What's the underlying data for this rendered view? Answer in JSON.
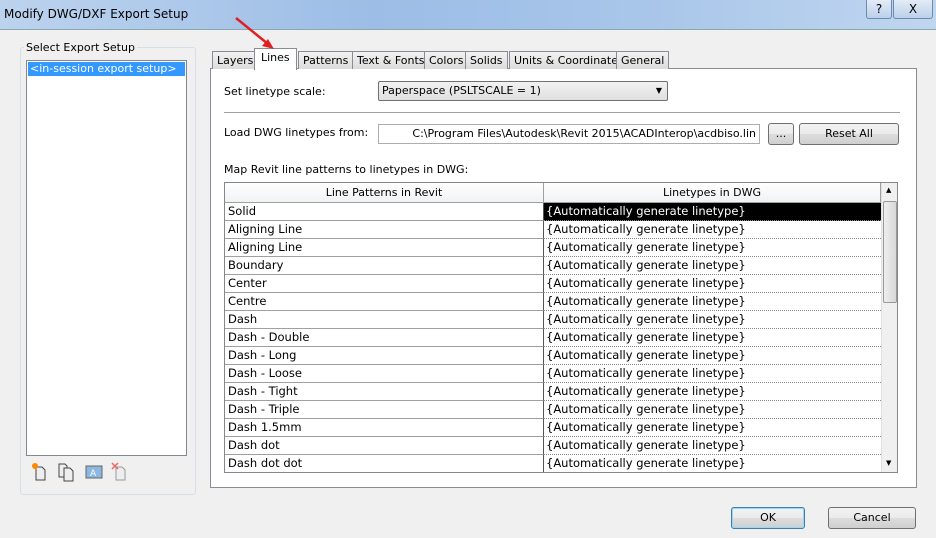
{
  "window": {
    "title": "Modify DWG/DXF Export Setup",
    "help": "?",
    "close": "X"
  },
  "left": {
    "group_label": "Select Export Setup",
    "items": [
      "<in-session export setup>"
    ],
    "icons": [
      "new-setup-icon",
      "duplicate-setup-icon",
      "rename-setup-icon",
      "delete-setup-icon"
    ]
  },
  "tabs": [
    "Layers",
    "Lines",
    "Patterns",
    "Text & Fonts",
    "Colors",
    "Solids",
    "Units & Coordinates",
    "General"
  ],
  "active_tab": "Lines",
  "lines": {
    "scale_label": "Set linetype scale:",
    "scale_value": "Paperspace (PSLTSCALE = 1)",
    "load_label": "Load DWG linetypes from:",
    "load_path": "C:\\Program Files\\Autodesk\\Revit 2015\\ACADInterop\\acdbiso.lin",
    "browse": "...",
    "reset": "Reset All",
    "map_label": "Map Revit line patterns to linetypes in DWG:",
    "columns": [
      "Line Patterns in Revit",
      "Linetypes in DWG"
    ],
    "rows": [
      [
        "Solid",
        "{Automatically generate linetype}"
      ],
      [
        "Aligning Line",
        "{Automatically generate linetype}"
      ],
      [
        "Aligning Line",
        "{Automatically generate linetype}"
      ],
      [
        "Boundary",
        "{Automatically generate linetype}"
      ],
      [
        "Center",
        "{Automatically generate linetype}"
      ],
      [
        "Centre",
        "{Automatically generate linetype}"
      ],
      [
        "Dash",
        "{Automatically generate linetype}"
      ],
      [
        "Dash - Double",
        "{Automatically generate linetype}"
      ],
      [
        "Dash - Long",
        "{Automatically generate linetype}"
      ],
      [
        "Dash - Loose",
        "{Automatically generate linetype}"
      ],
      [
        "Dash - Tight",
        "{Automatically generate linetype}"
      ],
      [
        "Dash - Triple",
        "{Automatically generate linetype}"
      ],
      [
        "Dash 1.5mm",
        "{Automatically generate linetype}"
      ],
      [
        "Dash dot",
        "{Automatically generate linetype}"
      ],
      [
        "Dash dot dot",
        "{Automatically generate linetype}"
      ]
    ],
    "selected_row": 0
  },
  "footer": {
    "ok": "OK",
    "cancel": "Cancel"
  },
  "annotation": {
    "arrow_color": "#e02020"
  }
}
